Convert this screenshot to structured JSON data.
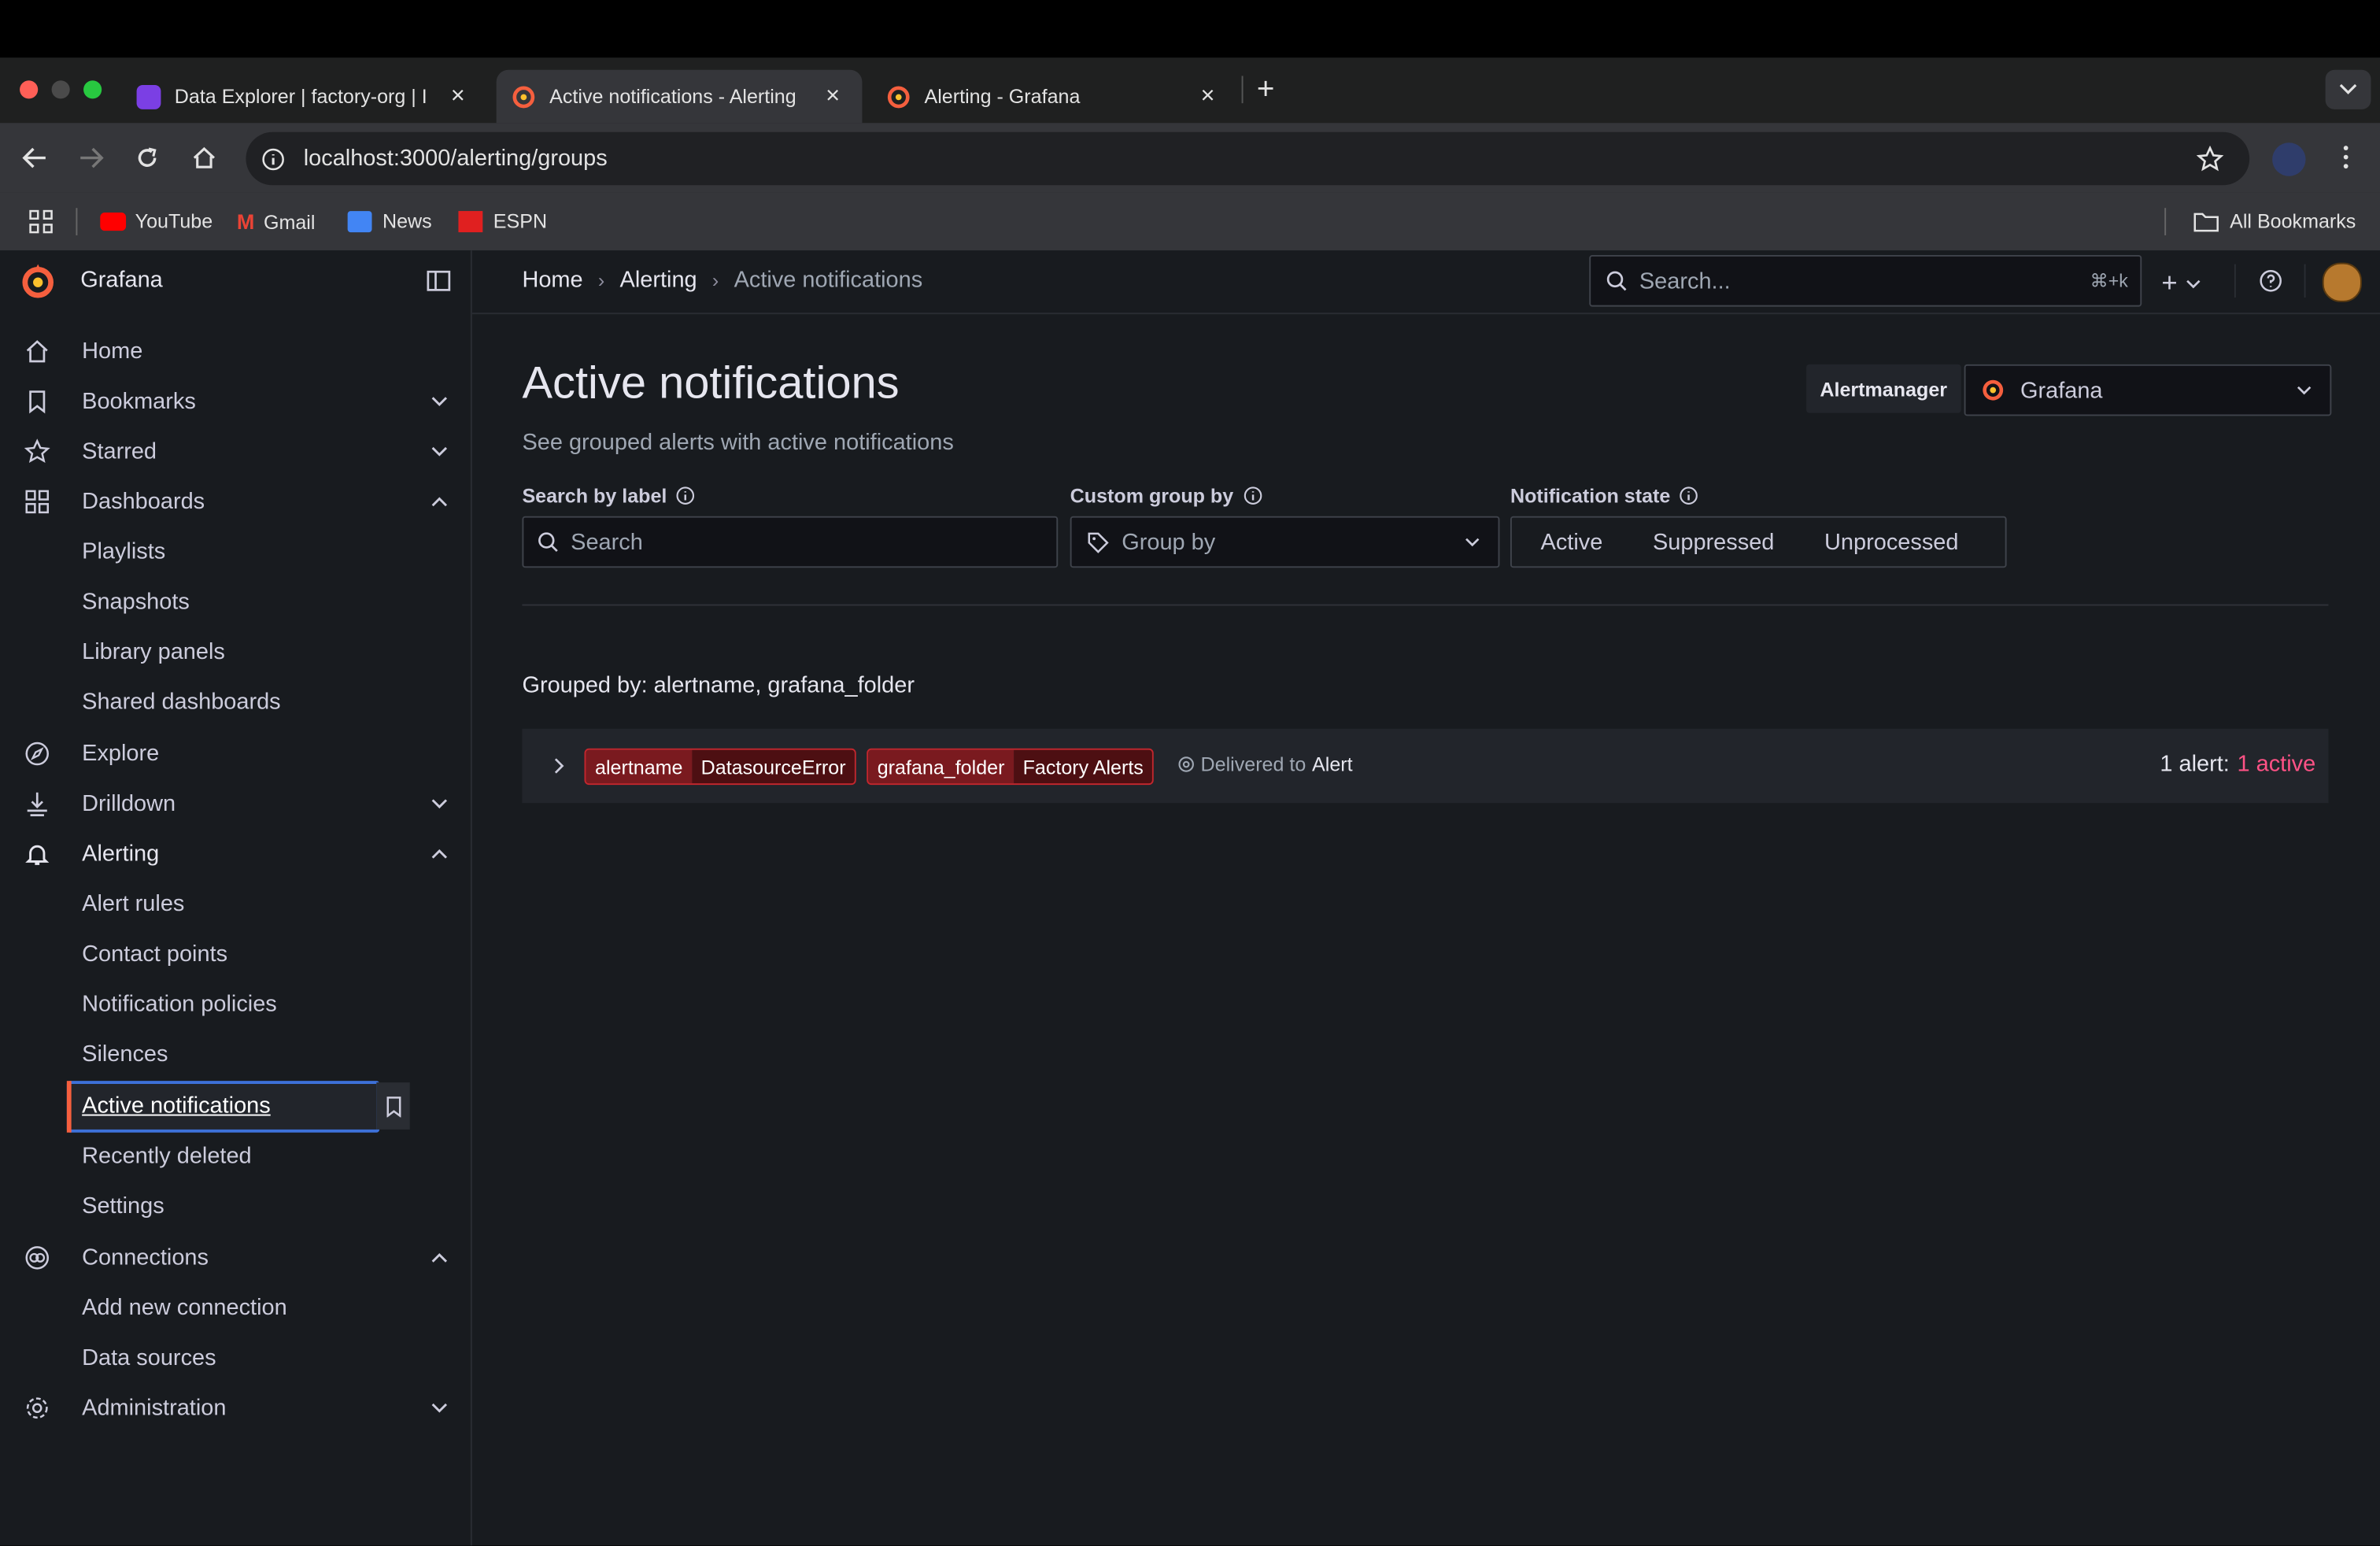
{
  "browser": {
    "tabs": [
      {
        "title": "Data Explorer | factory-org | I"
      },
      {
        "title": "Active notifications - Alerting"
      },
      {
        "title": "Alerting - Grafana"
      }
    ],
    "url": "localhost:3000/alerting/groups",
    "bookmarks": [
      "YouTube",
      "Gmail",
      "News",
      "ESPN"
    ],
    "all_bookmarks": "All Bookmarks"
  },
  "app": {
    "name": "Grafana",
    "breadcrumb": [
      "Home",
      "Alerting",
      "Active notifications"
    ],
    "search_placeholder": "Search...",
    "search_shortcut": "⌘+k"
  },
  "sidebar": {
    "home": "Home",
    "bookmarks": "Bookmarks",
    "starred": "Starred",
    "dashboards": "Dashboards",
    "dashboards_sub": [
      "Playlists",
      "Snapshots",
      "Library panels",
      "Shared dashboards"
    ],
    "explore": "Explore",
    "drilldown": "Drilldown",
    "alerting": "Alerting",
    "alerting_sub": [
      "Alert rules",
      "Contact points",
      "Notification policies",
      "Silences",
      "Active notifications",
      "Recently deleted",
      "Settings"
    ],
    "connections": "Connections",
    "connections_sub": [
      "Add new connection",
      "Data sources"
    ],
    "administration": "Administration"
  },
  "page": {
    "title": "Active notifications",
    "subtitle": "See grouped alerts with active notifications",
    "alertmanager_label": "Alertmanager",
    "alertmanager_value": "Grafana",
    "search_label": "Search by label",
    "search_placeholder": "Search",
    "group_label": "Custom group by",
    "group_placeholder": "Group by",
    "state_label": "Notification state",
    "states": [
      "Active",
      "Suppressed",
      "Unprocessed"
    ],
    "grouped_by": "Grouped by: alertname, grafana_folder",
    "group": {
      "label1_key": "alertname",
      "label1_val": "DatasourceError",
      "label2_key": "grafana_folder",
      "label2_val": "Factory Alerts",
      "delivered_prefix": "Delivered to",
      "delivered_target": "Alert",
      "count_prefix": "1 alert:",
      "count_active": "1 active"
    }
  },
  "colors": {
    "accent_orange": "#f55f3e",
    "active_red": "#ff5286",
    "selected_border": "#3d71d9",
    "pill_key": "#7a1a1f",
    "pill_val": "#4d0f12"
  }
}
